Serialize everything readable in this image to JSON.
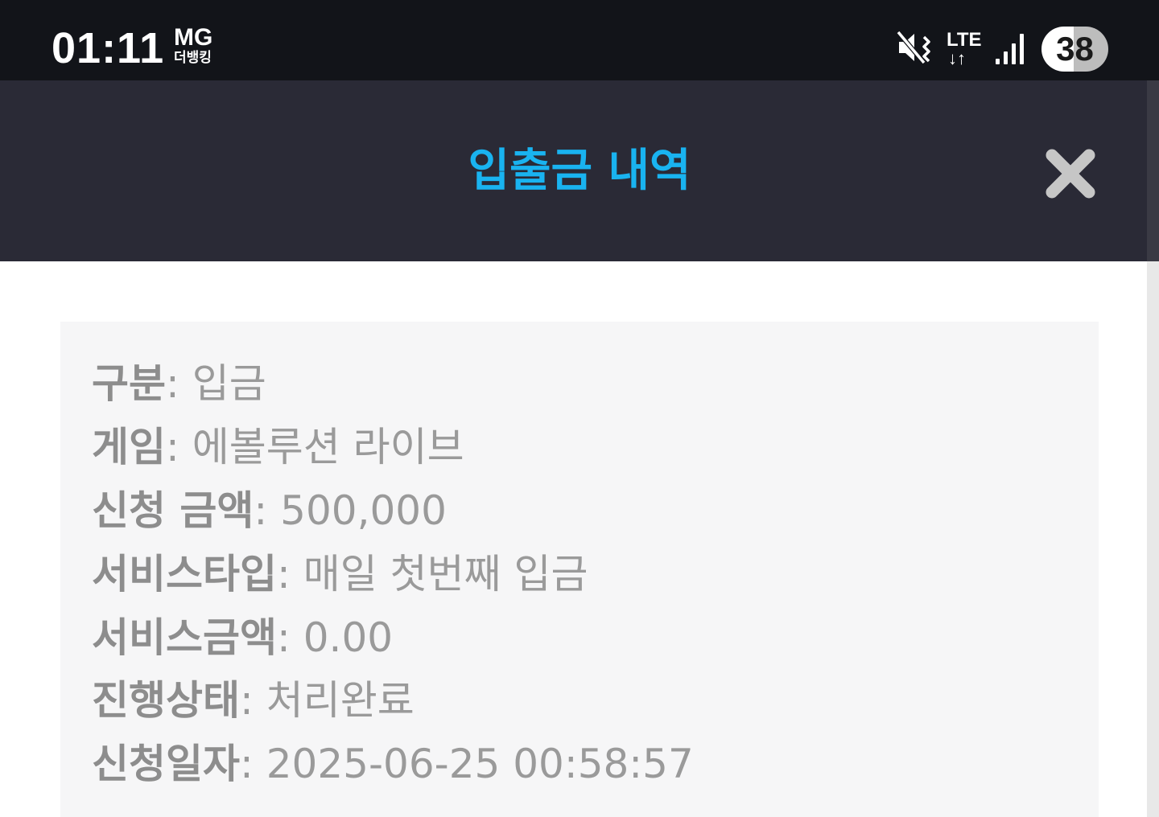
{
  "status_bar": {
    "time": "01:11",
    "carrier_top": "MG",
    "carrier_bottom": "더뱅킹",
    "network_label": "LTE",
    "network_arrows": "↓↑",
    "battery_level": "38",
    "icons": [
      "mute-icon",
      "lte-icon",
      "signal-icon",
      "battery-icon"
    ]
  },
  "header": {
    "title": "입출금 내역",
    "title_color": "#19b3f0",
    "close_icon": "close-icon"
  },
  "details": {
    "rows": [
      {
        "label": "구분",
        "sep": ": ",
        "value": "입금"
      },
      {
        "label": "게임",
        "sep": ": ",
        "value": "에볼루션 라이브"
      },
      {
        "label": "신청 금액",
        "sep": ": ",
        "value": "500,000"
      },
      {
        "label": "서비스타입",
        "sep": ": ",
        "value": "매일 첫번째 입금"
      },
      {
        "label": "서비스금액",
        "sep": ": ",
        "value": "0.00"
      },
      {
        "label": "진행상태",
        "sep": ": ",
        "value": "처리완료"
      },
      {
        "label": "신청일자",
        "sep": ": ",
        "value": "2025-06-25 00:58:57"
      }
    ]
  },
  "colors": {
    "status_bar_bg": "#121419",
    "header_bg": "#2a2a36",
    "card_bg": "#f6f6f7",
    "text_gray": "#9a9a9a"
  }
}
